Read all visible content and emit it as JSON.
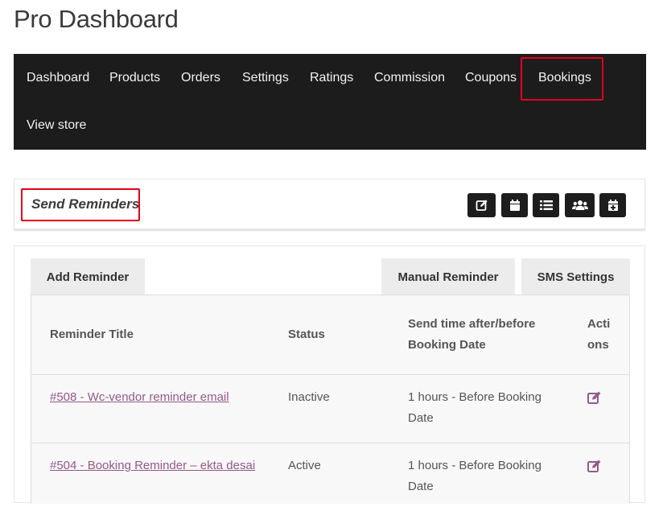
{
  "page": {
    "title": "Pro Dashboard"
  },
  "nav": {
    "items": [
      {
        "label": "Dashboard"
      },
      {
        "label": "Products"
      },
      {
        "label": "Orders"
      },
      {
        "label": "Settings"
      },
      {
        "label": "Ratings"
      },
      {
        "label": "Commission"
      },
      {
        "label": "Coupons"
      },
      {
        "label": "Bookings"
      },
      {
        "label": "View store"
      }
    ],
    "highlighted": "Bookings",
    "bg_color": "#1c1c1c"
  },
  "panel": {
    "heading": "Send Reminders",
    "toolbar_icons": [
      "edit-icon",
      "calendar-icon",
      "list-icon",
      "users-icon",
      "calendar-plus-icon"
    ]
  },
  "tabs": [
    {
      "label": "Add Reminder"
    },
    {
      "label": "Manual Reminder"
    },
    {
      "label": "SMS Settings"
    }
  ],
  "table": {
    "headers": {
      "title": "Reminder Title",
      "status": "Status",
      "send_time_line1": "Send time after/before",
      "send_time_line2": "Booking Date",
      "actions_line1": "Acti",
      "actions_line2": "ons"
    },
    "rows": [
      {
        "title": "#508 - Wc-vendor reminder email",
        "status": "Inactive",
        "time_line1": "1 hours - Before Booking",
        "time_line2": "Date"
      },
      {
        "title": "#504 - Booking Reminder – ekta desai",
        "status": "Active",
        "time_line1": "1 hours - Before Booking",
        "time_line2": "Date"
      }
    ]
  },
  "colors": {
    "highlight": "#e3001b",
    "link": "#96588a",
    "accent_icon": "#96588a"
  }
}
